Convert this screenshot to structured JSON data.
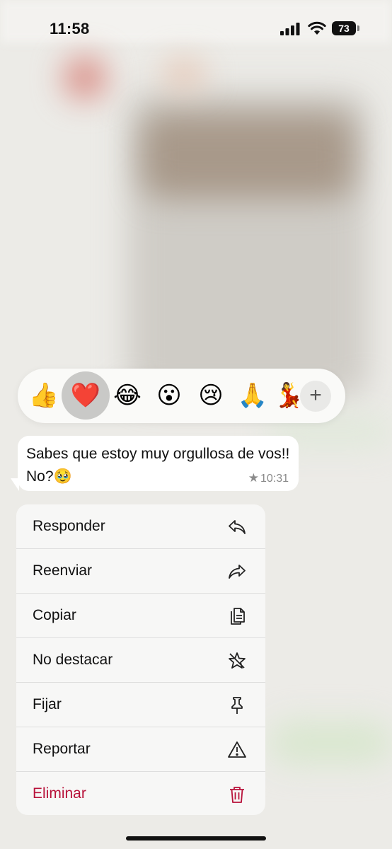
{
  "status_bar": {
    "time": "11:58",
    "battery": "73"
  },
  "reactions": {
    "items": [
      {
        "name": "thumbs-up",
        "glyph": "👍"
      },
      {
        "name": "red-heart",
        "glyph": "❤️",
        "selected": true
      },
      {
        "name": "tears-of-joy",
        "glyph": "😂"
      },
      {
        "name": "surprised",
        "glyph": "😮"
      },
      {
        "name": "crying",
        "glyph": "😢"
      },
      {
        "name": "folded-hands",
        "glyph": "🙏"
      },
      {
        "name": "dancer",
        "glyph": "💃"
      }
    ],
    "more_label": "+"
  },
  "message": {
    "text": "Sabes que estoy muy orgullosa de vos!! No?🥹",
    "starred": true,
    "star_glyph": "★",
    "time": "10:31"
  },
  "menu": {
    "items": [
      {
        "label": "Responder",
        "icon": "reply-icon"
      },
      {
        "label": "Reenviar",
        "icon": "forward-icon"
      },
      {
        "label": "Copiar",
        "icon": "copy-icon"
      },
      {
        "label": "No destacar",
        "icon": "unstar-icon"
      },
      {
        "label": "Fijar",
        "icon": "pin-icon"
      },
      {
        "label": "Reportar",
        "icon": "warning-icon"
      },
      {
        "label": "Eliminar",
        "icon": "trash-icon",
        "destructive": true
      }
    ]
  },
  "colors": {
    "destructive": "#b8123a",
    "selected_reaction_bg": "#c9c9c7"
  }
}
